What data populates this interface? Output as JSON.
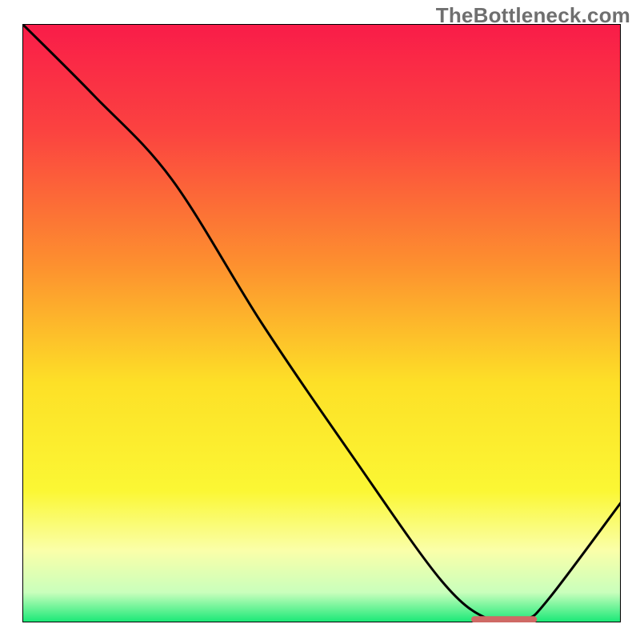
{
  "watermark": "TheBottleneck.com",
  "chart_data": {
    "type": "line",
    "title": "",
    "xlabel": "",
    "ylabel": "",
    "xlim": [
      0,
      100
    ],
    "ylim": [
      0,
      100
    ],
    "grid": false,
    "legend": false,
    "series": [
      {
        "name": "curve",
        "x": [
          0,
          12,
          25,
          40,
          55,
          70,
          78,
          84,
          88,
          100
        ],
        "y": [
          100,
          88,
          74,
          50,
          28,
          7,
          0.5,
          0.5,
          4,
          20
        ]
      }
    ],
    "markers": [
      {
        "name": "min-band",
        "x_start": 75,
        "x_end": 86,
        "y": 0.5,
        "color": "#cf6a65"
      }
    ],
    "background_gradient": [
      {
        "offset": 0.0,
        "color": "#f91c49"
      },
      {
        "offset": 0.18,
        "color": "#fb4340"
      },
      {
        "offset": 0.4,
        "color": "#fd8f2f"
      },
      {
        "offset": 0.6,
        "color": "#fde027"
      },
      {
        "offset": 0.78,
        "color": "#fbf734"
      },
      {
        "offset": 0.88,
        "color": "#faffa9"
      },
      {
        "offset": 0.95,
        "color": "#c9ffbc"
      },
      {
        "offset": 1.0,
        "color": "#17e876"
      }
    ]
  }
}
